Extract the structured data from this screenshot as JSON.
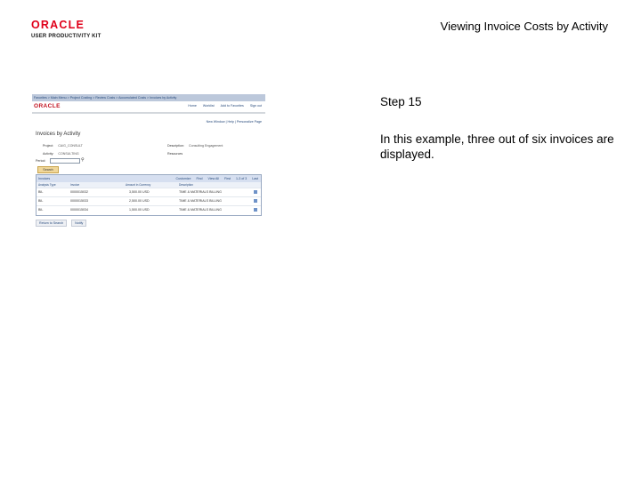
{
  "header": {
    "logo_top": "ORACLE",
    "logo_bottom": "USER PRODUCTIVITY KIT",
    "title": "Viewing Invoice Costs by Activity"
  },
  "step": {
    "label": "Step 15",
    "description": "In this example, three out of six invoices are displayed."
  },
  "screenshot": {
    "breadcrumb": "Favorites  >  Main Menu  >  Project Costing  >  Review Costs  >  Accumulated Costs  >  Invoices by Activity",
    "brand": "ORACLE",
    "top_links": [
      "Home",
      "Worklist",
      "Add to Favorites",
      "Sign out"
    ],
    "toolbar": "New Window  |  Help  |  Personalize Page",
    "page_title": "Invoices by Activity",
    "fields": {
      "project_label": "Project:",
      "project_value": "CA/G_CONSULT",
      "description_label": "Description:",
      "description_value": "Consulting Engagement",
      "activity_label": "Activity:",
      "activity_value": "CONSULTING",
      "activity_desc": "Resources",
      "period_label": "Period:"
    },
    "search_button": "Search",
    "grid": {
      "title": "Invoices",
      "nav": [
        "Customize",
        "Find",
        "View All",
        "First",
        "1-3 of 3",
        "Last"
      ],
      "columns": [
        "Analysis Type",
        "Invoice",
        "Amount in Currency",
        "Description"
      ],
      "rows": [
        {
          "type": "BIL",
          "invoice": "0000015032",
          "amount": "3,500.00 USD",
          "desc": "TIME & MATERIALS BILLING"
        },
        {
          "type": "BIL",
          "invoice": "0000015033",
          "amount": "2,500.00 USD",
          "desc": "TIME & MATERIALS BILLING"
        },
        {
          "type": "BIL",
          "invoice": "0000015034",
          "amount": "1,500.00 USD",
          "desc": "TIME & MATERIALS BILLING"
        }
      ]
    },
    "footer_buttons": [
      "Return to Search",
      "Notify"
    ]
  }
}
